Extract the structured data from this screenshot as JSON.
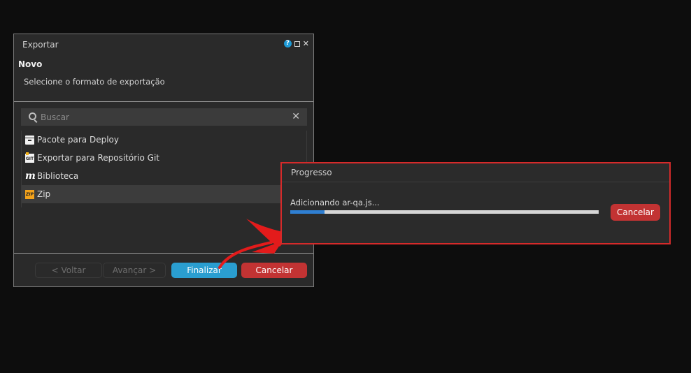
{
  "export_dialog": {
    "title": "Exportar",
    "heading": "Novo",
    "subtitle": "Selecione o formato de exportação",
    "search": {
      "placeholder": "Buscar",
      "value": ""
    },
    "items": [
      {
        "label": "Pacote para Deploy",
        "icon": "package-icon"
      },
      {
        "label": "Exportar para Repositório Git",
        "icon": "git-icon",
        "icon_text": "GIT"
      },
      {
        "label": "Biblioteca",
        "icon": "library-icon",
        "icon_text": "m"
      },
      {
        "label": "Zip",
        "icon": "zip-icon",
        "icon_text": "ZIP",
        "selected": true
      }
    ],
    "buttons": {
      "back": "< Voltar",
      "next": "Avançar >",
      "finish": "Finalizar",
      "cancel": "Cancelar"
    },
    "help_glyph": "?",
    "close_glyph": "✕"
  },
  "progress_dialog": {
    "title": "Progresso",
    "status": "Adicionando ar-qa.js...",
    "progress_fraction": 0.11,
    "cancel": "Cancelar"
  },
  "colors": {
    "accent_blue": "#2a9ed0",
    "danger_red": "#c23333",
    "highlight_border": "#d52a2a",
    "annotation_arrow": "#e31b1b"
  }
}
